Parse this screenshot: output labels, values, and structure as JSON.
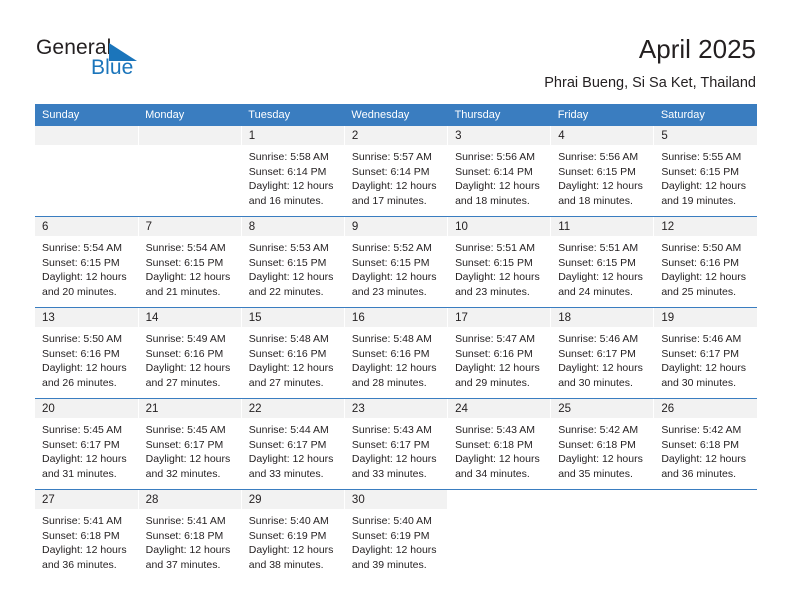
{
  "brand": {
    "name_top": "General",
    "name_bottom": "Blue",
    "triangle_color": "#1b75bb",
    "text_color": "#231f20"
  },
  "header": {
    "title": "April 2025",
    "subtitle": "Phrai Bueng, Si Sa Ket, Thailand",
    "header_bg": "#3a7dc0",
    "header_text_color": "#ffffff",
    "daynum_bg": "#f2f2f2"
  },
  "weekdays": [
    "Sunday",
    "Monday",
    "Tuesday",
    "Wednesday",
    "Thursday",
    "Friday",
    "Saturday"
  ],
  "weeks": [
    [
      {
        "day": "",
        "sunrise": "",
        "sunset": "",
        "daylight_1": "",
        "daylight_2": "",
        "empty": true
      },
      {
        "day": "",
        "sunrise": "",
        "sunset": "",
        "daylight_1": "",
        "daylight_2": "",
        "empty": true
      },
      {
        "day": "1",
        "sunrise": "Sunrise: 5:58 AM",
        "sunset": "Sunset: 6:14 PM",
        "daylight_1": "Daylight: 12 hours",
        "daylight_2": "and 16 minutes."
      },
      {
        "day": "2",
        "sunrise": "Sunrise: 5:57 AM",
        "sunset": "Sunset: 6:14 PM",
        "daylight_1": "Daylight: 12 hours",
        "daylight_2": "and 17 minutes."
      },
      {
        "day": "3",
        "sunrise": "Sunrise: 5:56 AM",
        "sunset": "Sunset: 6:14 PM",
        "daylight_1": "Daylight: 12 hours",
        "daylight_2": "and 18 minutes."
      },
      {
        "day": "4",
        "sunrise": "Sunrise: 5:56 AM",
        "sunset": "Sunset: 6:15 PM",
        "daylight_1": "Daylight: 12 hours",
        "daylight_2": "and 18 minutes."
      },
      {
        "day": "5",
        "sunrise": "Sunrise: 5:55 AM",
        "sunset": "Sunset: 6:15 PM",
        "daylight_1": "Daylight: 12 hours",
        "daylight_2": "and 19 minutes."
      }
    ],
    [
      {
        "day": "6",
        "sunrise": "Sunrise: 5:54 AM",
        "sunset": "Sunset: 6:15 PM",
        "daylight_1": "Daylight: 12 hours",
        "daylight_2": "and 20 minutes."
      },
      {
        "day": "7",
        "sunrise": "Sunrise: 5:54 AM",
        "sunset": "Sunset: 6:15 PM",
        "daylight_1": "Daylight: 12 hours",
        "daylight_2": "and 21 minutes."
      },
      {
        "day": "8",
        "sunrise": "Sunrise: 5:53 AM",
        "sunset": "Sunset: 6:15 PM",
        "daylight_1": "Daylight: 12 hours",
        "daylight_2": "and 22 minutes."
      },
      {
        "day": "9",
        "sunrise": "Sunrise: 5:52 AM",
        "sunset": "Sunset: 6:15 PM",
        "daylight_1": "Daylight: 12 hours",
        "daylight_2": "and 23 minutes."
      },
      {
        "day": "10",
        "sunrise": "Sunrise: 5:51 AM",
        "sunset": "Sunset: 6:15 PM",
        "daylight_1": "Daylight: 12 hours",
        "daylight_2": "and 23 minutes."
      },
      {
        "day": "11",
        "sunrise": "Sunrise: 5:51 AM",
        "sunset": "Sunset: 6:15 PM",
        "daylight_1": "Daylight: 12 hours",
        "daylight_2": "and 24 minutes."
      },
      {
        "day": "12",
        "sunrise": "Sunrise: 5:50 AM",
        "sunset": "Sunset: 6:16 PM",
        "daylight_1": "Daylight: 12 hours",
        "daylight_2": "and 25 minutes."
      }
    ],
    [
      {
        "day": "13",
        "sunrise": "Sunrise: 5:50 AM",
        "sunset": "Sunset: 6:16 PM",
        "daylight_1": "Daylight: 12 hours",
        "daylight_2": "and 26 minutes."
      },
      {
        "day": "14",
        "sunrise": "Sunrise: 5:49 AM",
        "sunset": "Sunset: 6:16 PM",
        "daylight_1": "Daylight: 12 hours",
        "daylight_2": "and 27 minutes."
      },
      {
        "day": "15",
        "sunrise": "Sunrise: 5:48 AM",
        "sunset": "Sunset: 6:16 PM",
        "daylight_1": "Daylight: 12 hours",
        "daylight_2": "and 27 minutes."
      },
      {
        "day": "16",
        "sunrise": "Sunrise: 5:48 AM",
        "sunset": "Sunset: 6:16 PM",
        "daylight_1": "Daylight: 12 hours",
        "daylight_2": "and 28 minutes."
      },
      {
        "day": "17",
        "sunrise": "Sunrise: 5:47 AM",
        "sunset": "Sunset: 6:16 PM",
        "daylight_1": "Daylight: 12 hours",
        "daylight_2": "and 29 minutes."
      },
      {
        "day": "18",
        "sunrise": "Sunrise: 5:46 AM",
        "sunset": "Sunset: 6:17 PM",
        "daylight_1": "Daylight: 12 hours",
        "daylight_2": "and 30 minutes."
      },
      {
        "day": "19",
        "sunrise": "Sunrise: 5:46 AM",
        "sunset": "Sunset: 6:17 PM",
        "daylight_1": "Daylight: 12 hours",
        "daylight_2": "and 30 minutes."
      }
    ],
    [
      {
        "day": "20",
        "sunrise": "Sunrise: 5:45 AM",
        "sunset": "Sunset: 6:17 PM",
        "daylight_1": "Daylight: 12 hours",
        "daylight_2": "and 31 minutes."
      },
      {
        "day": "21",
        "sunrise": "Sunrise: 5:45 AM",
        "sunset": "Sunset: 6:17 PM",
        "daylight_1": "Daylight: 12 hours",
        "daylight_2": "and 32 minutes."
      },
      {
        "day": "22",
        "sunrise": "Sunrise: 5:44 AM",
        "sunset": "Sunset: 6:17 PM",
        "daylight_1": "Daylight: 12 hours",
        "daylight_2": "and 33 minutes."
      },
      {
        "day": "23",
        "sunrise": "Sunrise: 5:43 AM",
        "sunset": "Sunset: 6:17 PM",
        "daylight_1": "Daylight: 12 hours",
        "daylight_2": "and 33 minutes."
      },
      {
        "day": "24",
        "sunrise": "Sunrise: 5:43 AM",
        "sunset": "Sunset: 6:18 PM",
        "daylight_1": "Daylight: 12 hours",
        "daylight_2": "and 34 minutes."
      },
      {
        "day": "25",
        "sunrise": "Sunrise: 5:42 AM",
        "sunset": "Sunset: 6:18 PM",
        "daylight_1": "Daylight: 12 hours",
        "daylight_2": "and 35 minutes."
      },
      {
        "day": "26",
        "sunrise": "Sunrise: 5:42 AM",
        "sunset": "Sunset: 6:18 PM",
        "daylight_1": "Daylight: 12 hours",
        "daylight_2": "and 36 minutes."
      }
    ],
    [
      {
        "day": "27",
        "sunrise": "Sunrise: 5:41 AM",
        "sunset": "Sunset: 6:18 PM",
        "daylight_1": "Daylight: 12 hours",
        "daylight_2": "and 36 minutes."
      },
      {
        "day": "28",
        "sunrise": "Sunrise: 5:41 AM",
        "sunset": "Sunset: 6:18 PM",
        "daylight_1": "Daylight: 12 hours",
        "daylight_2": "and 37 minutes."
      },
      {
        "day": "29",
        "sunrise": "Sunrise: 5:40 AM",
        "sunset": "Sunset: 6:19 PM",
        "daylight_1": "Daylight: 12 hours",
        "daylight_2": "and 38 minutes."
      },
      {
        "day": "30",
        "sunrise": "Sunrise: 5:40 AM",
        "sunset": "Sunset: 6:19 PM",
        "daylight_1": "Daylight: 12 hours",
        "daylight_2": "and 39 minutes."
      },
      {
        "day": "",
        "sunrise": "",
        "sunset": "",
        "daylight_1": "",
        "daylight_2": "",
        "blank": true
      },
      {
        "day": "",
        "sunrise": "",
        "sunset": "",
        "daylight_1": "",
        "daylight_2": "",
        "blank": true
      },
      {
        "day": "",
        "sunrise": "",
        "sunset": "",
        "daylight_1": "",
        "daylight_2": "",
        "blank": true
      }
    ]
  ]
}
